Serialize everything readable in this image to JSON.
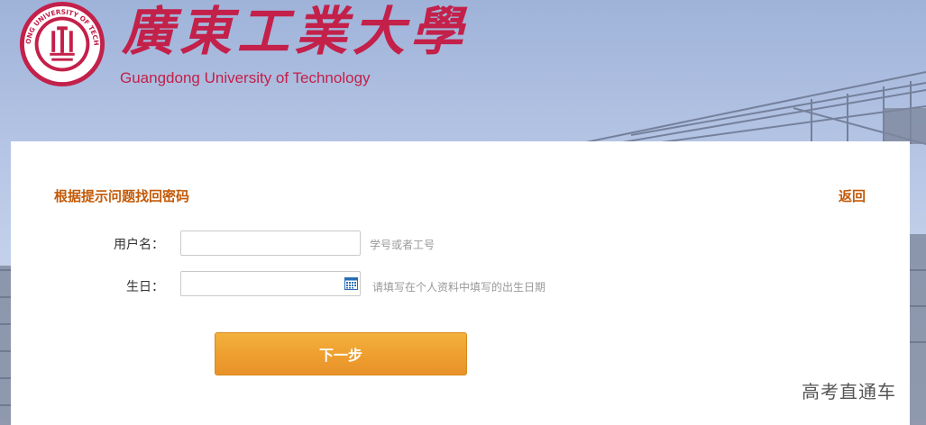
{
  "header": {
    "logo_name_cn": "廣東工業大學",
    "logo_name_en": "Guangdong University of Technology",
    "seal_text": "GUANGDONG UNIVERSITY OF TECHNOLOGY"
  },
  "form": {
    "title": "根据提示问题找回密码",
    "back_label": "返回",
    "username_label": "用户名：",
    "username_value": "",
    "username_hint": "学号或者工号",
    "birthday_label": "生日：",
    "birthday_value": "",
    "birthday_hint": "请填写在个人资料中填写的出生日期",
    "next_label": "下一步"
  },
  "watermark": "高考直通车",
  "colors": {
    "brand_red": "#c3204a",
    "title_orange": "#c35a08",
    "button_orange": "#eea030"
  },
  "icons": [
    "calendar-icon",
    "university-seal-logo"
  ]
}
